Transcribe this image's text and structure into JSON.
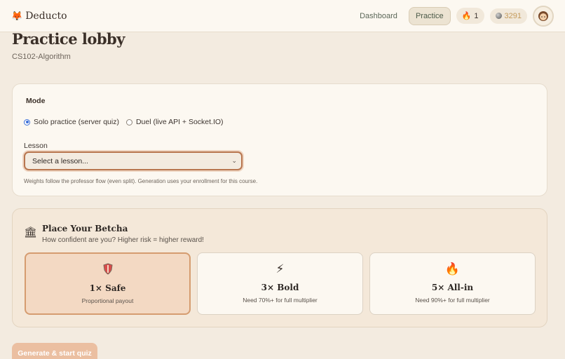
{
  "header": {
    "brand": "Deducto",
    "nav": {
      "dashboard": "Dashboard",
      "practice": "Practice"
    },
    "streak": "1",
    "coins": "3291"
  },
  "page": {
    "title": "Practice lobby",
    "course": "CS102-Algorithm"
  },
  "mode": {
    "title": "Mode",
    "options": [
      {
        "label": "Solo practice (server quiz)",
        "checked": true
      },
      {
        "label": "Duel (live API + Socket.IO)",
        "checked": false
      }
    ],
    "lesson_label": "Lesson",
    "lesson_value": "Select a lesson...",
    "hint": "Weights follow the professor flow (even split). Generation uses your enrollment for this course."
  },
  "bet": {
    "title": "Place Your Betcha",
    "subtitle": "How confident are you? Higher risk = higher reward!",
    "options": [
      {
        "name": "1× Safe",
        "desc": "Proportional payout",
        "icon": "shield-icon",
        "selected": true
      },
      {
        "name": "3× Bold",
        "desc": "Need 70%+ for full multiplier",
        "icon": "lightning-icon",
        "selected": false
      },
      {
        "name": "5× All-in",
        "desc": "Need 90%+ for full multiplier",
        "icon": "fire-icon",
        "selected": false
      }
    ]
  },
  "actions": {
    "generate": "Generate & start quiz"
  },
  "colors": {
    "accent": "#b8764f",
    "selected_bg": "#f3d9c3",
    "button": "#ebbfa1"
  }
}
